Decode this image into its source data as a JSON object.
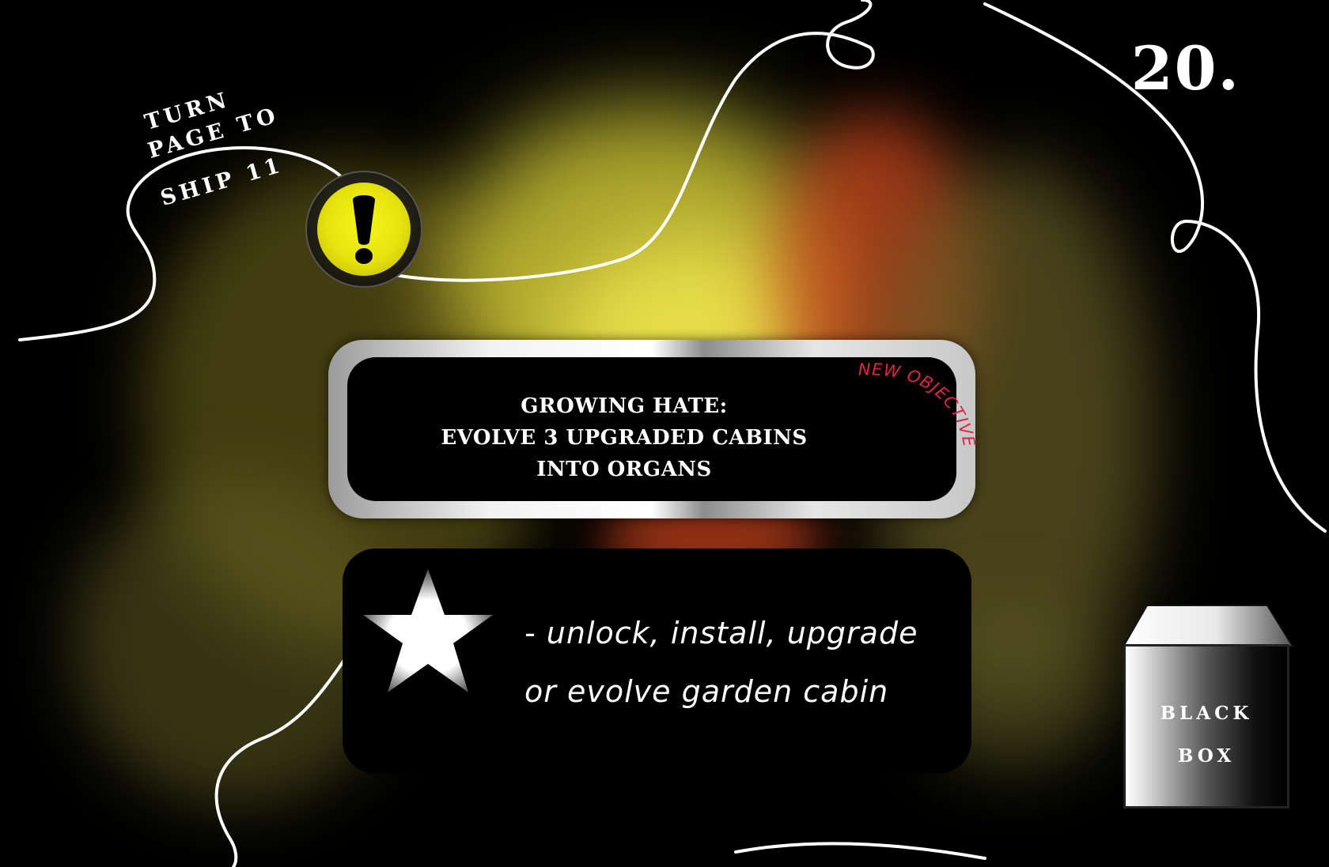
{
  "page": {
    "number": "20."
  },
  "turn_note": {
    "line1": "TURN",
    "line2": "PAGE TO",
    "line3": "SHIP 11"
  },
  "alert": {
    "icon": "exclamation-icon",
    "color": "#f4f21a"
  },
  "objective": {
    "badge": "NEW OBJECTIVE",
    "line1": "GROWING HATE:",
    "line2": "EVOLVE 3 UPGRADED CABINS",
    "line3": "INTO ORGANS",
    "badge_color": "#e0234d"
  },
  "reward": {
    "icon": "star-icon",
    "line1": "- unlock, install, upgrade",
    "line2": "or evolve garden cabin"
  },
  "black_box": {
    "line1": "BLACK",
    "line2": "BOX"
  },
  "colors": {
    "background": "#000000",
    "smoke_yellow": "#d8d238",
    "smoke_red": "#b83a1a"
  }
}
